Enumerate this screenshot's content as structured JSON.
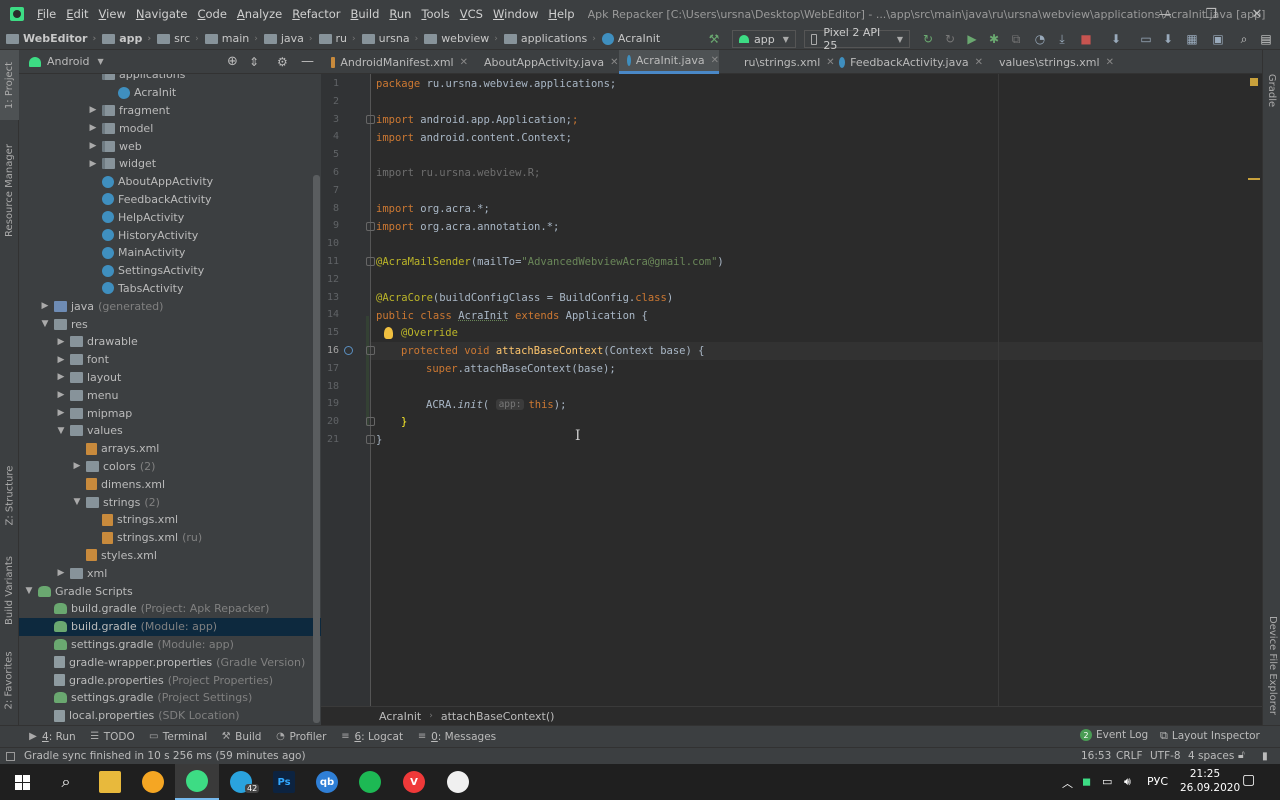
{
  "menu": [
    "File",
    "Edit",
    "View",
    "Navigate",
    "Code",
    "Analyze",
    "Refactor",
    "Build",
    "Run",
    "Tools",
    "VCS",
    "Window",
    "Help"
  ],
  "window_title": "Apk Repacker [C:\\Users\\ursna\\Desktop\\WebEditor] - ...\\app\\src\\main\\java\\ru\\ursna\\webview\\applications\\AcraInit.java [app]",
  "window_controls": {
    "minimize": "—",
    "maximize": "❐",
    "close": "✕"
  },
  "breadcrumbs": [
    "WebEditor",
    "app",
    "src",
    "main",
    "java",
    "ru",
    "ursna",
    "webview",
    "applications",
    "AcraInit"
  ],
  "run_config": "app",
  "device": "Pixel 2 API 25",
  "project_view": "Android",
  "tree": [
    {
      "label": "applications",
      "indent": 4,
      "arrow": "",
      "icon": "pkg",
      "hint": ""
    },
    {
      "label": "AcraInit",
      "indent": 5,
      "arrow": "",
      "icon": "cls",
      "hint": ""
    },
    {
      "label": "fragment",
      "indent": 4,
      "arrow": "▶",
      "icon": "pkg",
      "hint": ""
    },
    {
      "label": "model",
      "indent": 4,
      "arrow": "▶",
      "icon": "pkg",
      "hint": ""
    },
    {
      "label": "web",
      "indent": 4,
      "arrow": "▶",
      "icon": "pkg",
      "hint": ""
    },
    {
      "label": "widget",
      "indent": 4,
      "arrow": "▶",
      "icon": "pkg",
      "hint": ""
    },
    {
      "label": "AboutAppActivity",
      "indent": 4,
      "arrow": "",
      "icon": "cls",
      "hint": ""
    },
    {
      "label": "FeedbackActivity",
      "indent": 4,
      "arrow": "",
      "icon": "cls",
      "hint": ""
    },
    {
      "label": "HelpActivity",
      "indent": 4,
      "arrow": "",
      "icon": "cls",
      "hint": ""
    },
    {
      "label": "HistoryActivity",
      "indent": 4,
      "arrow": "",
      "icon": "cls",
      "hint": ""
    },
    {
      "label": "MainActivity",
      "indent": 4,
      "arrow": "",
      "icon": "cls",
      "hint": ""
    },
    {
      "label": "SettingsActivity",
      "indent": 4,
      "arrow": "",
      "icon": "cls",
      "hint": ""
    },
    {
      "label": "TabsActivity",
      "indent": 4,
      "arrow": "",
      "icon": "cls",
      "hint": ""
    },
    {
      "label": "java",
      "indent": 1,
      "arrow": "▶",
      "icon": "java",
      "hint": "(generated)"
    },
    {
      "label": "res",
      "indent": 1,
      "arrow": "▼",
      "icon": "folder",
      "hint": ""
    },
    {
      "label": "drawable",
      "indent": 2,
      "arrow": "▶",
      "icon": "folder",
      "hint": ""
    },
    {
      "label": "font",
      "indent": 2,
      "arrow": "▶",
      "icon": "folder",
      "hint": ""
    },
    {
      "label": "layout",
      "indent": 2,
      "arrow": "▶",
      "icon": "folder",
      "hint": ""
    },
    {
      "label": "menu",
      "indent": 2,
      "arrow": "▶",
      "icon": "folder",
      "hint": ""
    },
    {
      "label": "mipmap",
      "indent": 2,
      "arrow": "▶",
      "icon": "folder",
      "hint": ""
    },
    {
      "label": "values",
      "indent": 2,
      "arrow": "▼",
      "icon": "folder",
      "hint": ""
    },
    {
      "label": "arrays.xml",
      "indent": 3,
      "arrow": "",
      "icon": "xml",
      "hint": ""
    },
    {
      "label": "colors",
      "indent": 3,
      "arrow": "▶",
      "icon": "folder",
      "hint": "(2)"
    },
    {
      "label": "dimens.xml",
      "indent": 3,
      "arrow": "",
      "icon": "xml",
      "hint": ""
    },
    {
      "label": "strings",
      "indent": 3,
      "arrow": "▼",
      "icon": "folder",
      "hint": "(2)"
    },
    {
      "label": "strings.xml",
      "indent": 4,
      "arrow": "",
      "icon": "xml",
      "hint": ""
    },
    {
      "label": "strings.xml",
      "indent": 4,
      "arrow": "",
      "icon": "xml",
      "hint": "(ru)"
    },
    {
      "label": "styles.xml",
      "indent": 3,
      "arrow": "",
      "icon": "xml",
      "hint": ""
    },
    {
      "label": "xml",
      "indent": 2,
      "arrow": "▶",
      "icon": "folder",
      "hint": ""
    },
    {
      "label": "Gradle Scripts",
      "indent": 0,
      "arrow": "▼",
      "icon": "gradlefolder",
      "hint": ""
    },
    {
      "label": "build.gradle",
      "indent": 1,
      "arrow": "",
      "icon": "gradle",
      "hint": "(Project: Apk Repacker)"
    },
    {
      "label": "build.gradle",
      "indent": 1,
      "arrow": "",
      "icon": "gradle",
      "hint": "(Module: app)",
      "selected": true
    },
    {
      "label": "settings.gradle",
      "indent": 1,
      "arrow": "",
      "icon": "gradle",
      "hint": "(Module: app)"
    },
    {
      "label": "gradle-wrapper.properties",
      "indent": 1,
      "arrow": "",
      "icon": "props",
      "hint": "(Gradle Version)"
    },
    {
      "label": "gradle.properties",
      "indent": 1,
      "arrow": "",
      "icon": "props",
      "hint": "(Project Properties)"
    },
    {
      "label": "settings.gradle",
      "indent": 1,
      "arrow": "",
      "icon": "gradle",
      "hint": "(Project Settings)"
    },
    {
      "label": "local.properties",
      "indent": 1,
      "arrow": "",
      "icon": "props",
      "hint": "(SDK Location)"
    }
  ],
  "tabs": [
    {
      "label": "AndroidManifest.xml",
      "color": "#c88a3c",
      "active": false
    },
    {
      "label": "AboutAppActivity.java",
      "color": "#3f8fbf",
      "active": false
    },
    {
      "label": "AcraInit.java",
      "color": "#3f8fbf",
      "active": true
    },
    {
      "label": "ru\\strings.xml",
      "color": "#c88a3c",
      "active": false
    },
    {
      "label": "FeedbackActivity.java",
      "color": "#3f8fbf",
      "active": false
    },
    {
      "label": "values\\strings.xml",
      "color": "#c88a3c",
      "active": false
    }
  ],
  "code": {
    "l1_kw": "package",
    "l1_rest": " ru.ursna.webview.applications;",
    "l3_kw": "import",
    "l3_rest": " android.app.Application;",
    "l4_kw": "import",
    "l4_rest": " android.content.Context;",
    "l6": "import ru.ursna.webview.R;",
    "l8_kw": "import",
    "l8_rest": " org.acra.*;",
    "l9_kw": "import",
    "l9_rest": " org.acra.annotation.*;",
    "l11_ann": "@AcraMailSender",
    "l11_open": "(",
    "l11_param": "mailTo",
    "l11_eq": "=",
    "l11_str": "\"AdvancedWebviewAcra@gmail.com\"",
    "l11_close": ")",
    "l13_ann": "@AcraCore",
    "l13_open": "(",
    "l13_param": "buildConfigClass",
    "l13_mid": " = BuildConfig.",
    "l13_kw": "class",
    "l13_close": ")",
    "l14_kw1": "public class ",
    "l14_name": "AcraInit",
    "l14_kw2": " extends ",
    "l14_rest": "Application {",
    "l15_ann": "@Override",
    "l16_kw": "protected void ",
    "l16_fn": "attachBaseContext",
    "l16_rest": "(Context base) {",
    "l17_kw": "super",
    "l17_rest": ".attachBaseContext(base);",
    "l19_a": "ACRA.",
    "l19_fn": "init",
    "l19_open": "( ",
    "l19_hint": "app:",
    "l19_kw": "this",
    "l19_close": ");",
    "l20": "}",
    "l21": "}"
  },
  "line_numbers": [
    "1",
    "2",
    "3",
    "4",
    "5",
    "6",
    "7",
    "8",
    "9",
    "10",
    "11",
    "12",
    "13",
    "14",
    "15",
    "16",
    "17",
    "18",
    "19",
    "20",
    "21"
  ],
  "editor_breadcrumb": [
    "AcraInit",
    "attachBaseContext()"
  ],
  "bottom_tools": [
    {
      "icon": "▶",
      "num": "4",
      "label": ": Run"
    },
    {
      "icon": "☰",
      "num": "",
      "label": "TODO"
    },
    {
      "icon": "▭",
      "num": "",
      "label": "Terminal"
    },
    {
      "icon": "⚒",
      "num": "",
      "label": "Build"
    },
    {
      "icon": "◔",
      "num": "",
      "label": "Profiler"
    },
    {
      "icon": "≡",
      "num": "6",
      "label": ": Logcat"
    },
    {
      "icon": "≡",
      "num": "0",
      "label": ": Messages"
    }
  ],
  "event_log": {
    "badge": "2",
    "label": "Event Log"
  },
  "layout_inspector": "Layout Inspector",
  "status_message": "Gradle sync finished in 10 s 256 ms (59 minutes ago)",
  "status_right": {
    "position": "16:53",
    "line_sep": "CRLF",
    "encoding": "UTF-8",
    "indent": "4 spaces"
  },
  "left_tabs": [
    "1: Project",
    "Resource Manager",
    "Z: Structure",
    "Build Variants",
    "2: Favorites"
  ],
  "right_tabs": [
    "Gradle",
    "Device File Explorer"
  ],
  "taskbar_apps": [
    {
      "name": "explorer",
      "glyph": "",
      "color": "#e8b93c"
    },
    {
      "name": "yandex-browser",
      "glyph": "",
      "color": "#f5a623"
    },
    {
      "name": "android-studio",
      "glyph": "",
      "color": "#3ddc84"
    },
    {
      "name": "telegram",
      "glyph": "",
      "color": "#2aa3de"
    },
    {
      "name": "photoshop",
      "glyph": "Ps",
      "color": "#0c2340"
    },
    {
      "name": "qbittorrent",
      "glyph": "qb",
      "color": "#2f7fd6"
    },
    {
      "name": "spotify",
      "glyph": "",
      "color": "#1db954"
    },
    {
      "name": "vivaldi",
      "glyph": "V",
      "color": "#ef3939"
    },
    {
      "name": "android-studio-2",
      "glyph": "",
      "color": "#f0f0f0"
    }
  ],
  "telegram_badge": "42",
  "tray": {
    "lang": "РУС",
    "time": "21:25",
    "date": "26.09.2020"
  }
}
